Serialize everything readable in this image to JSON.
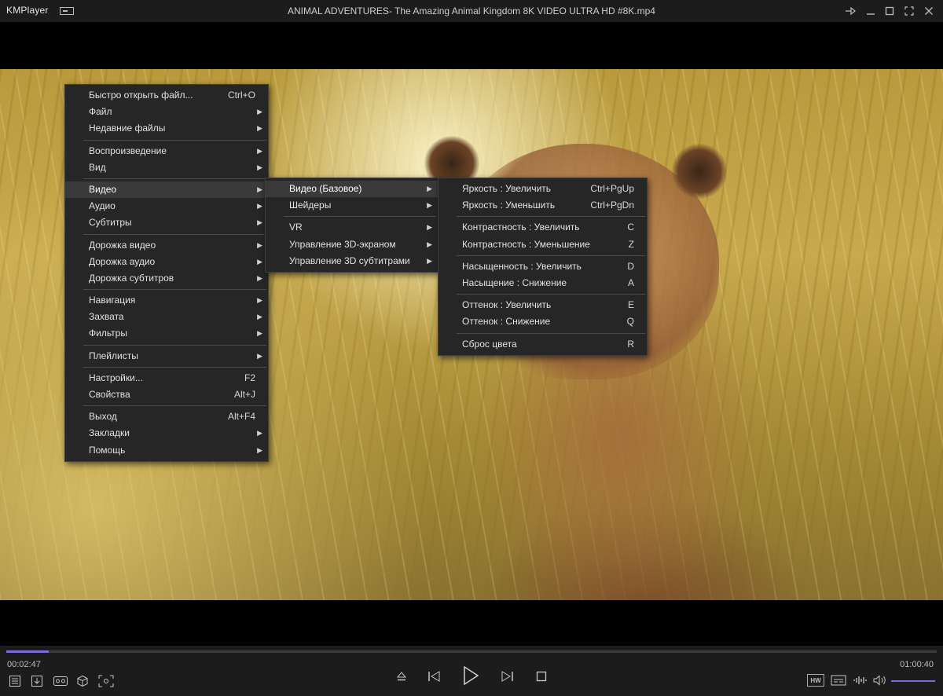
{
  "app": {
    "logo": "KMPlayer",
    "title": "ANIMAL ADVENTURES- The Amazing Animal Kingdom 8K VIDEO ULTRA HD #8K.mp4"
  },
  "window_buttons": [
    "pin-icon",
    "minimize-icon",
    "maximize-icon",
    "fullscreen-icon",
    "close-icon"
  ],
  "main_menu": {
    "items": [
      {
        "label": "Быстро открыть файл...",
        "shortcut": "Ctrl+O"
      },
      {
        "label": "Файл",
        "submenu": true
      },
      {
        "label": "Недавние файлы",
        "submenu": true
      },
      {
        "label": "Воспроизведение",
        "submenu": true
      },
      {
        "label": "Вид",
        "submenu": true
      },
      {
        "label": "Видео",
        "submenu": true,
        "active": true
      },
      {
        "label": "Аудио",
        "submenu": true
      },
      {
        "label": "Субтитры",
        "submenu": true
      },
      {
        "label": "Дорожка видео",
        "submenu": true
      },
      {
        "label": "Дорожка аудио",
        "submenu": true
      },
      {
        "label": "Дорожка субтитров",
        "submenu": true
      },
      {
        "label": "Навигация",
        "submenu": true
      },
      {
        "label": "Захвата",
        "submenu": true
      },
      {
        "label": "Фильтры",
        "submenu": true
      },
      {
        "label": "Плейлисты",
        "submenu": true
      },
      {
        "label": "Настройки...",
        "shortcut": "F2"
      },
      {
        "label": "Свойства",
        "shortcut": "Alt+J"
      },
      {
        "label": "Выход",
        "shortcut": "Alt+F4"
      },
      {
        "label": "Закладки",
        "submenu": true
      },
      {
        "label": "Помощь",
        "submenu": true
      }
    ]
  },
  "video_menu": {
    "items": [
      {
        "label": "Видео (Базовое)",
        "submenu": true,
        "active": true
      },
      {
        "label": "Шейдеры",
        "submenu": true
      },
      {
        "label": "VR",
        "submenu": true
      },
      {
        "label": "Управление 3D-экраном",
        "submenu": true
      },
      {
        "label": "Управление 3D субтитрами",
        "submenu": true
      }
    ]
  },
  "basic_video_menu": {
    "items": [
      {
        "label": "Яркость : Увеличить",
        "shortcut": "Ctrl+PgUp"
      },
      {
        "label": "Яркость : Уменьшить",
        "shortcut": "Ctrl+PgDn"
      },
      {
        "label": "Контрастность : Увеличить",
        "shortcut": "C"
      },
      {
        "label": "Контрастность : Уменьшение",
        "shortcut": "Z"
      },
      {
        "label": "Насыщенность : Увеличить",
        "shortcut": "D"
      },
      {
        "label": "Насыщение : Снижение",
        "shortcut": "A"
      },
      {
        "label": "Оттенок : Увеличить",
        "shortcut": "E"
      },
      {
        "label": "Оттенок : Снижение",
        "shortcut": "Q"
      },
      {
        "label": "Сброс цвета",
        "shortcut": "R"
      }
    ]
  },
  "player": {
    "current_time": "00:02:47",
    "total_time": "01:00:40",
    "progress": 0.046,
    "volume": 1.0,
    "accent_color": "#7b6cd9",
    "hw_badge": "HW"
  }
}
